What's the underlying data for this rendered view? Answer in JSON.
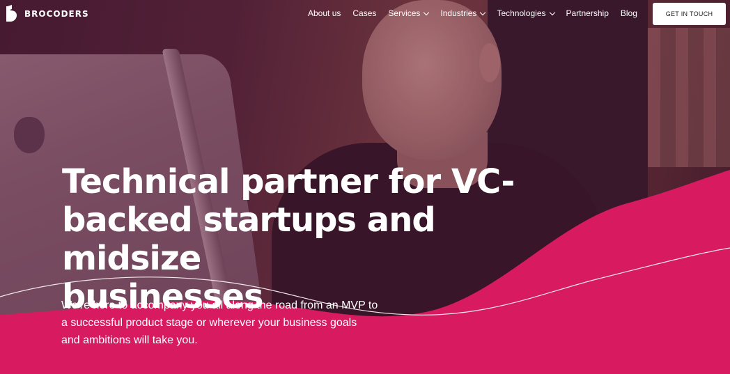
{
  "brand": {
    "name": "BROCODERS",
    "accent": "#d81b60"
  },
  "nav": {
    "items": [
      {
        "label": "About us",
        "dropdown": false
      },
      {
        "label": "Cases",
        "dropdown": false
      },
      {
        "label": "Services",
        "dropdown": true
      },
      {
        "label": "Industries",
        "dropdown": true
      },
      {
        "label": "Technologies",
        "dropdown": true
      },
      {
        "label": "Partnership",
        "dropdown": false
      },
      {
        "label": "Blog",
        "dropdown": false
      }
    ],
    "cta_label": "GET IN TOUCH"
  },
  "hero": {
    "headline_lines": [
      "Technical partner for VC-",
      "backed startups and midsize",
      "businesses"
    ],
    "subtext_lines": [
      "We're here to accompany you all along the road from an MVP to",
      "a successful product stage or wherever your business goals",
      "and ambitions will take you."
    ]
  }
}
